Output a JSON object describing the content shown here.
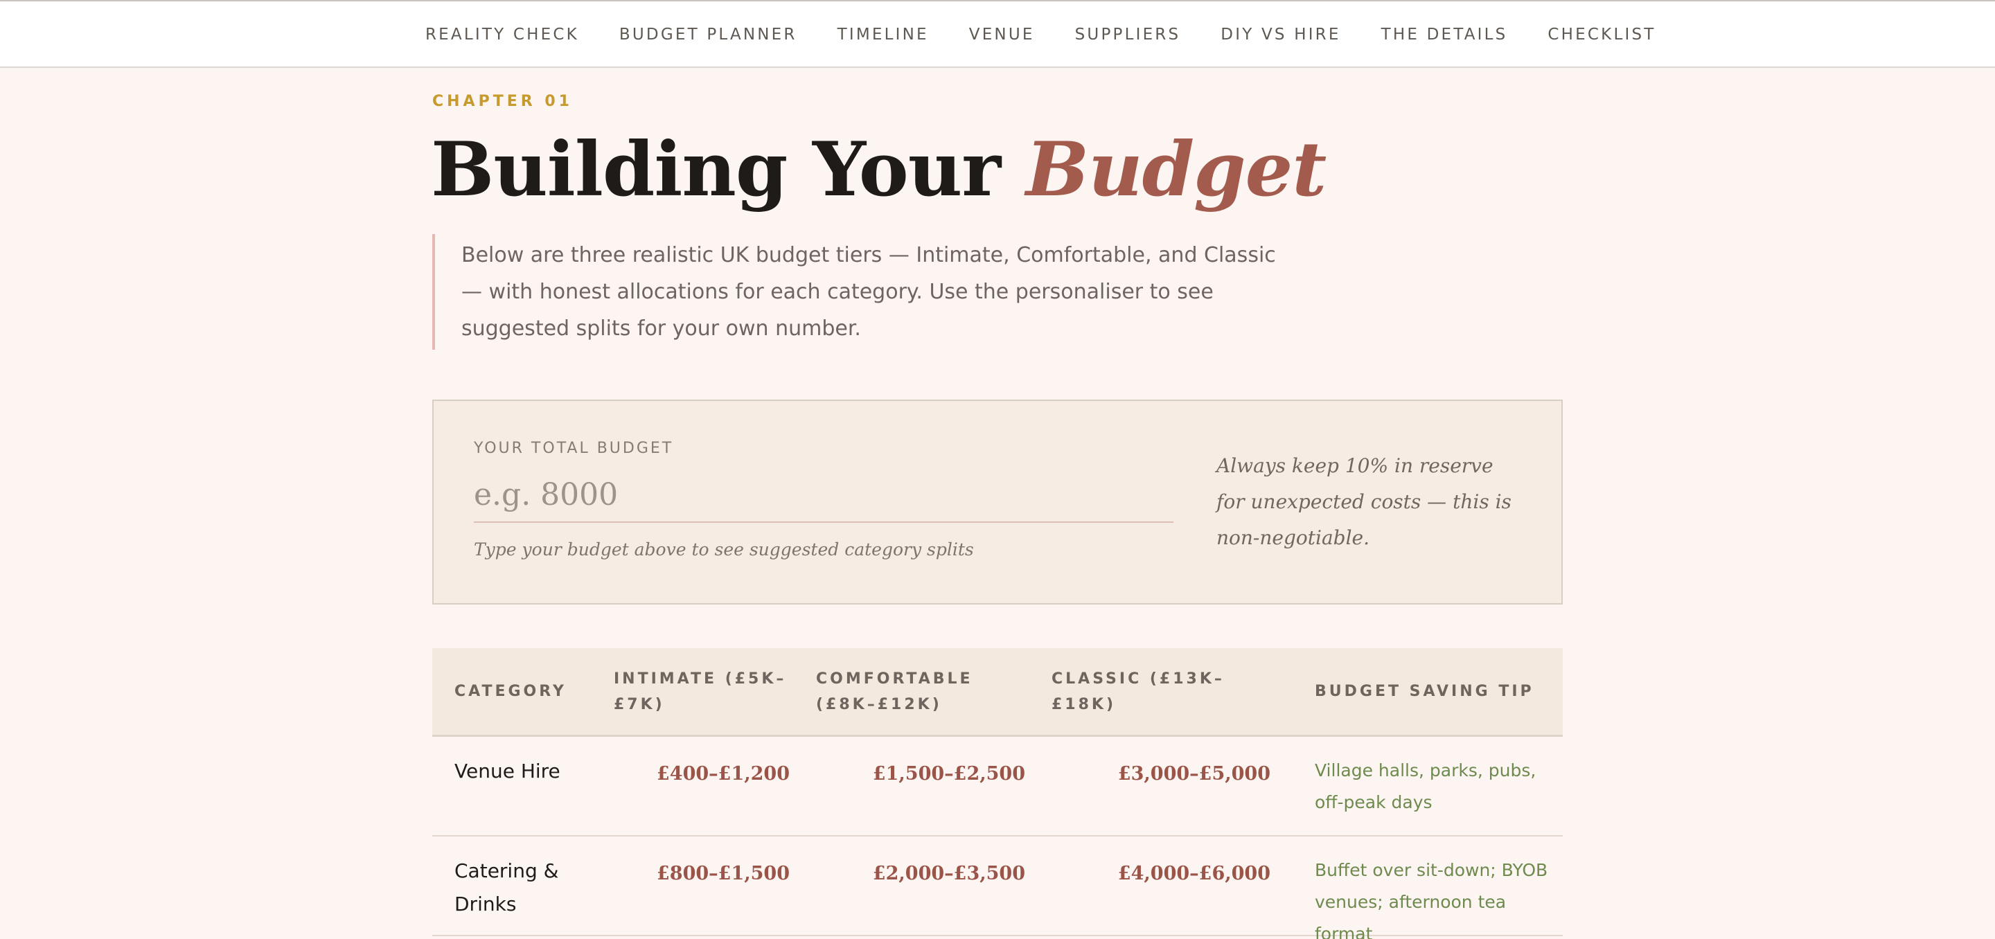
{
  "nav": {
    "items": [
      "REALITY CHECK",
      "BUDGET PLANNER",
      "TIMELINE",
      "VENUE",
      "SUPPLIERS",
      "DIY VS HIRE",
      "THE DETAILS",
      "CHECKLIST"
    ]
  },
  "chapter": {
    "eyebrow": "CHAPTER 01",
    "title_main": "Building Your ",
    "title_accent": "Budget",
    "lede": "Below are three realistic UK budget tiers — Intimate, Comfortable, and Classic — with honest allocations for each category. Use the personaliser to see suggested splits for your own number."
  },
  "budget": {
    "label": "YOUR TOTAL BUDGET",
    "placeholder": "e.g. 8000",
    "value": "",
    "hint": "Type your budget above to see suggested category splits",
    "note": "Always keep 10% in reserve for unexpected costs — this is non-negotiable."
  },
  "table": {
    "headers": [
      "CATEGORY",
      "INTIMATE (£5K–£7K)",
      "COMFORTABLE (£8K–£12K)",
      "CLASSIC (£13K–£18K)",
      "BUDGET SAVING TIP"
    ],
    "rows": [
      {
        "category": "Venue Hire",
        "intimate": "£400–£1,200",
        "comfortable": "£1,500–£2,500",
        "classic": "£3,000–£5,000",
        "tip": "Village halls, parks, pubs, off-peak days"
      },
      {
        "category": "Catering & Drinks",
        "intimate": "£800–£1,500",
        "comfortable": "£2,000–£3,500",
        "classic": "£4,000–£6,000",
        "tip": "Buffet over sit-down; BYOB venues; afternoon tea format"
      }
    ]
  }
}
